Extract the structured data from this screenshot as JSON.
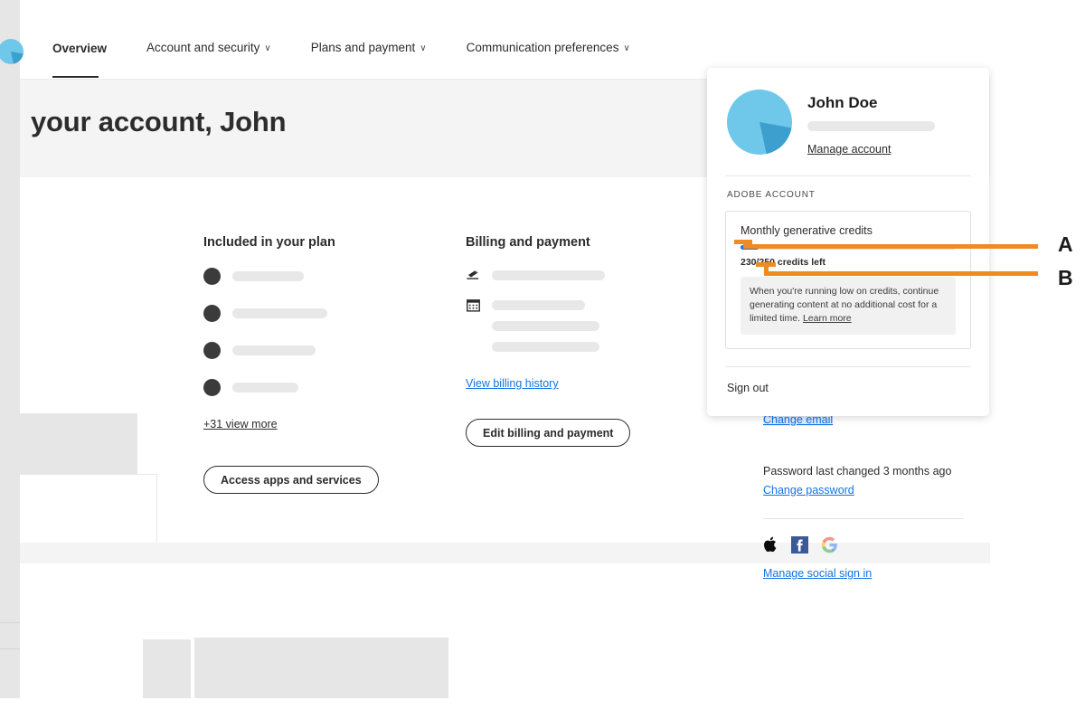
{
  "nav": {
    "items": [
      {
        "label": "Overview",
        "active": true,
        "caret": ""
      },
      {
        "label": "Account and security",
        "active": false,
        "caret": "∨"
      },
      {
        "label": "Plans and payment",
        "active": false,
        "caret": "∨"
      },
      {
        "label": "Communication preferences",
        "active": false,
        "caret": "∨"
      }
    ],
    "avatar_icon": "user-avatar-icon"
  },
  "hero": {
    "title": "your account, John"
  },
  "plan": {
    "title": "Included in your plan",
    "view_more_link": "+31 view more",
    "action_button": "Access apps and services",
    "rows": 4
  },
  "billing": {
    "title": "Billing and payment",
    "payment_icon": "payment-card-icon",
    "calendar_icon": "calendar-icon",
    "history_link": "View billing history",
    "action_button": "Edit billing and payment"
  },
  "panel": {
    "name": "John Doe",
    "manage_account_link": "Manage account",
    "section_label": "ADOBE ACCOUNT",
    "avatar_icon": "user-avatar-icon",
    "credits": {
      "title": "Monthly generative credits",
      "used_percent": 8,
      "remaining_label": "230/250 credits left",
      "remaining": 230,
      "total": 250,
      "note_text": "When you're running low on credits, continue generating content at no additional cost for a limited time. ",
      "note_link": "Learn more"
    },
    "sign_out": "Sign out"
  },
  "right_column": {
    "change_email_link": "Change email",
    "password_status": "Password last changed 3 months ago",
    "change_password_link": "Change password",
    "social_icons": [
      "apple-icon",
      "facebook-icon",
      "google-icon"
    ],
    "manage_social_link": "Manage social sign in"
  },
  "annotations": [
    {
      "id": "A",
      "label": "A"
    },
    {
      "id": "B",
      "label": "B"
    }
  ],
  "colors": {
    "accent_link": "#1473e6",
    "annotation": "#ee8b22",
    "avatar_light": "#6fc7ea",
    "avatar_dark": "#3d9fce",
    "page_bg": "#f4f4f4"
  }
}
